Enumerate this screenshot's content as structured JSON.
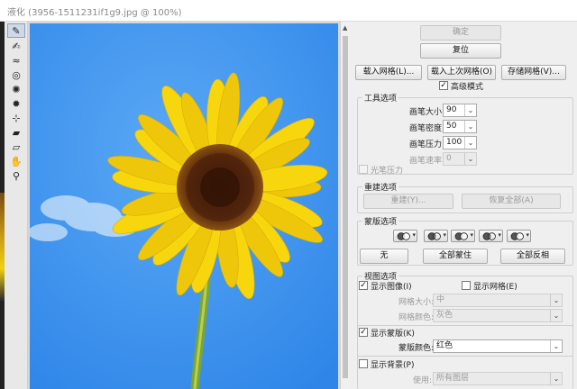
{
  "window": {
    "title": "液化 (3956-1511231if1g9.jpg @ 100%)"
  },
  "toolbar": {
    "tools": [
      {
        "name": "forward-warp-tool-icon",
        "glyph": "✎",
        "selected": true
      },
      {
        "name": "reconstruct-tool-icon",
        "glyph": "✍"
      },
      {
        "name": "smooth-tool-icon",
        "glyph": "≈"
      },
      {
        "name": "twirl-clockwise-tool-icon",
        "glyph": "◎"
      },
      {
        "name": "pucker-tool-icon",
        "glyph": "✺"
      },
      {
        "name": "bloat-tool-icon",
        "glyph": "✹"
      },
      {
        "name": "push-left-tool-icon",
        "glyph": "⊹"
      },
      {
        "name": "freeze-mask-tool-icon",
        "glyph": "▰"
      },
      {
        "name": "thaw-mask-tool-icon",
        "glyph": "▱"
      },
      {
        "name": "hand-tool-icon",
        "glyph": "✋"
      },
      {
        "name": "zoom-tool-icon",
        "glyph": "⚲"
      }
    ]
  },
  "panel": {
    "ok_label": "确定",
    "reset_label": "复位",
    "load_mesh_label": "载入网格(L)...",
    "load_last_mesh_label": "载入上次网格(O)",
    "save_mesh_label": "存储网格(V)...",
    "advanced_mode_label": "高级模式",
    "advanced_mode_checked": true,
    "tool_options": {
      "title": "工具选项",
      "brush_size_label": "画笔大小:",
      "brush_size_value": "90",
      "brush_density_label": "画笔密度:",
      "brush_density_value": "50",
      "brush_pressure_label": "画笔压力:",
      "brush_pressure_value": "100",
      "brush_rate_label": "画笔速率:",
      "brush_rate_value": "0",
      "stylus_pressure_label": "光笔压力"
    },
    "reconstruct": {
      "title": "重建选项",
      "reconstruct_label": "重建(Y)...",
      "restore_all_label": "恢复全部(A)"
    },
    "mask": {
      "title": "蒙版选项",
      "none_label": "无",
      "mask_all_label": "全部蒙住",
      "invert_all_label": "全部反相"
    },
    "view": {
      "title": "视图选项",
      "show_image_label": "显示图像(I)",
      "show_image_checked": true,
      "show_mesh_label": "显示网格(E)",
      "show_mesh_checked": false,
      "mesh_size_label": "网格大小:",
      "mesh_size_value": "中",
      "mesh_color_label": "网格颜色:",
      "mesh_color_value": "灰色",
      "show_mask_label": "显示蒙版(K)",
      "show_mask_checked": true,
      "mask_color_label": "蒙版颜色:",
      "mask_color_value": "红色",
      "show_backdrop_label": "显示背景(P)",
      "show_backdrop_checked": false,
      "use_label": "使用:",
      "use_value": "所有图层"
    }
  },
  "colors": {
    "sky": "#3f94ee",
    "petal": "#f6d50c",
    "center": "#4a1f0c",
    "stem": "#7ea62c"
  }
}
